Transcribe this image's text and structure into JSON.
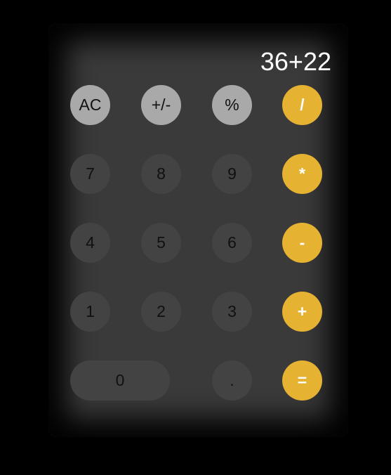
{
  "display": {
    "expression": "36+22"
  },
  "buttons": {
    "clear": "AC",
    "sign": "+/-",
    "percent": "%",
    "divide": "/",
    "seven": "7",
    "eight": "8",
    "nine": "9",
    "multiply": "*",
    "four": "4",
    "five": "5",
    "six": "6",
    "subtract": "-",
    "one": "1",
    "two": "2",
    "three": "3",
    "add": "+",
    "zero": "0",
    "decimal": ".",
    "equals": "="
  },
  "colors": {
    "page_background": "#000000",
    "body": "#3a3a3a",
    "function_key": "#a9a9a9",
    "number_key": "#434343",
    "operator_key": "#e5b232",
    "display_text": "#ffffff"
  }
}
